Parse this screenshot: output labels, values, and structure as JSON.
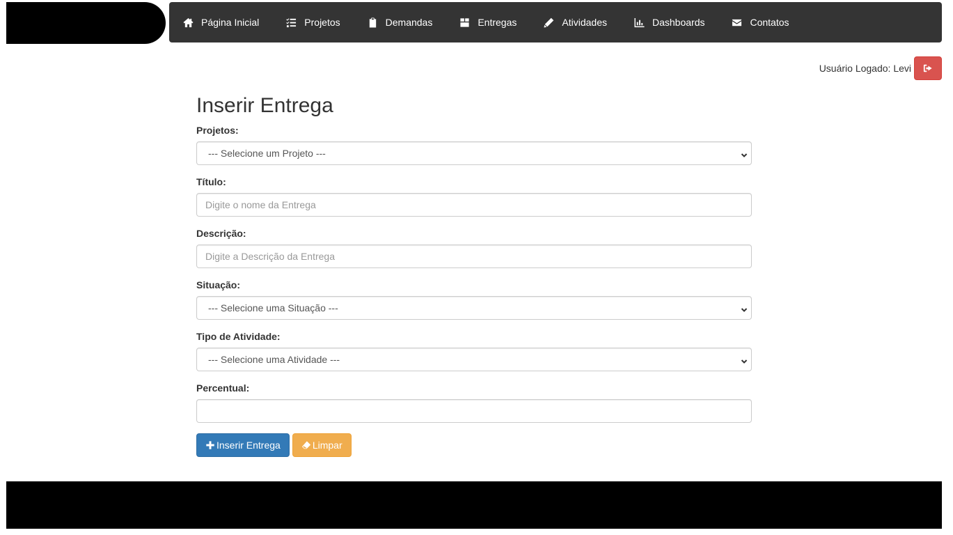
{
  "nav": {
    "items": [
      {
        "label": "Página Inicial",
        "icon": "home-icon"
      },
      {
        "label": "Projetos",
        "icon": "tasks-icon"
      },
      {
        "label": "Demandas",
        "icon": "clipboard-icon"
      },
      {
        "label": "Entregas",
        "icon": "box-icon"
      },
      {
        "label": "Atividades",
        "icon": "pencil-icon"
      },
      {
        "label": "Dashboards",
        "icon": "chart-icon"
      },
      {
        "label": "Contatos",
        "icon": "envelope-icon"
      }
    ]
  },
  "user": {
    "label": "Usuário Logado: Levi",
    "logout_icon": "sign-out-icon"
  },
  "form": {
    "title": "Inserir Entrega",
    "projetos": {
      "label": "Projetos:",
      "selected": "--- Selecione um Projeto ---"
    },
    "titulo": {
      "label": "Título:",
      "placeholder": "Digite o nome da Entrega",
      "value": ""
    },
    "descricao": {
      "label": "Descrição:",
      "placeholder": "Digite a Descrição da Entrega",
      "value": ""
    },
    "situacao": {
      "label": "Situação:",
      "selected": "--- Selecione uma Situação ---"
    },
    "tipo_atividade": {
      "label": "Tipo de Atividade:",
      "selected": "--- Selecione uma Atividade ---"
    },
    "percentual": {
      "label": "Percentual:",
      "value": ""
    },
    "buttons": {
      "insert_label": "Inserir Entrega",
      "clear_label": "Limpar"
    }
  },
  "colors": {
    "navbar_bg": "#343434",
    "primary": "#337ab7",
    "warning": "#f0ad4e",
    "danger": "#d9534f"
  }
}
